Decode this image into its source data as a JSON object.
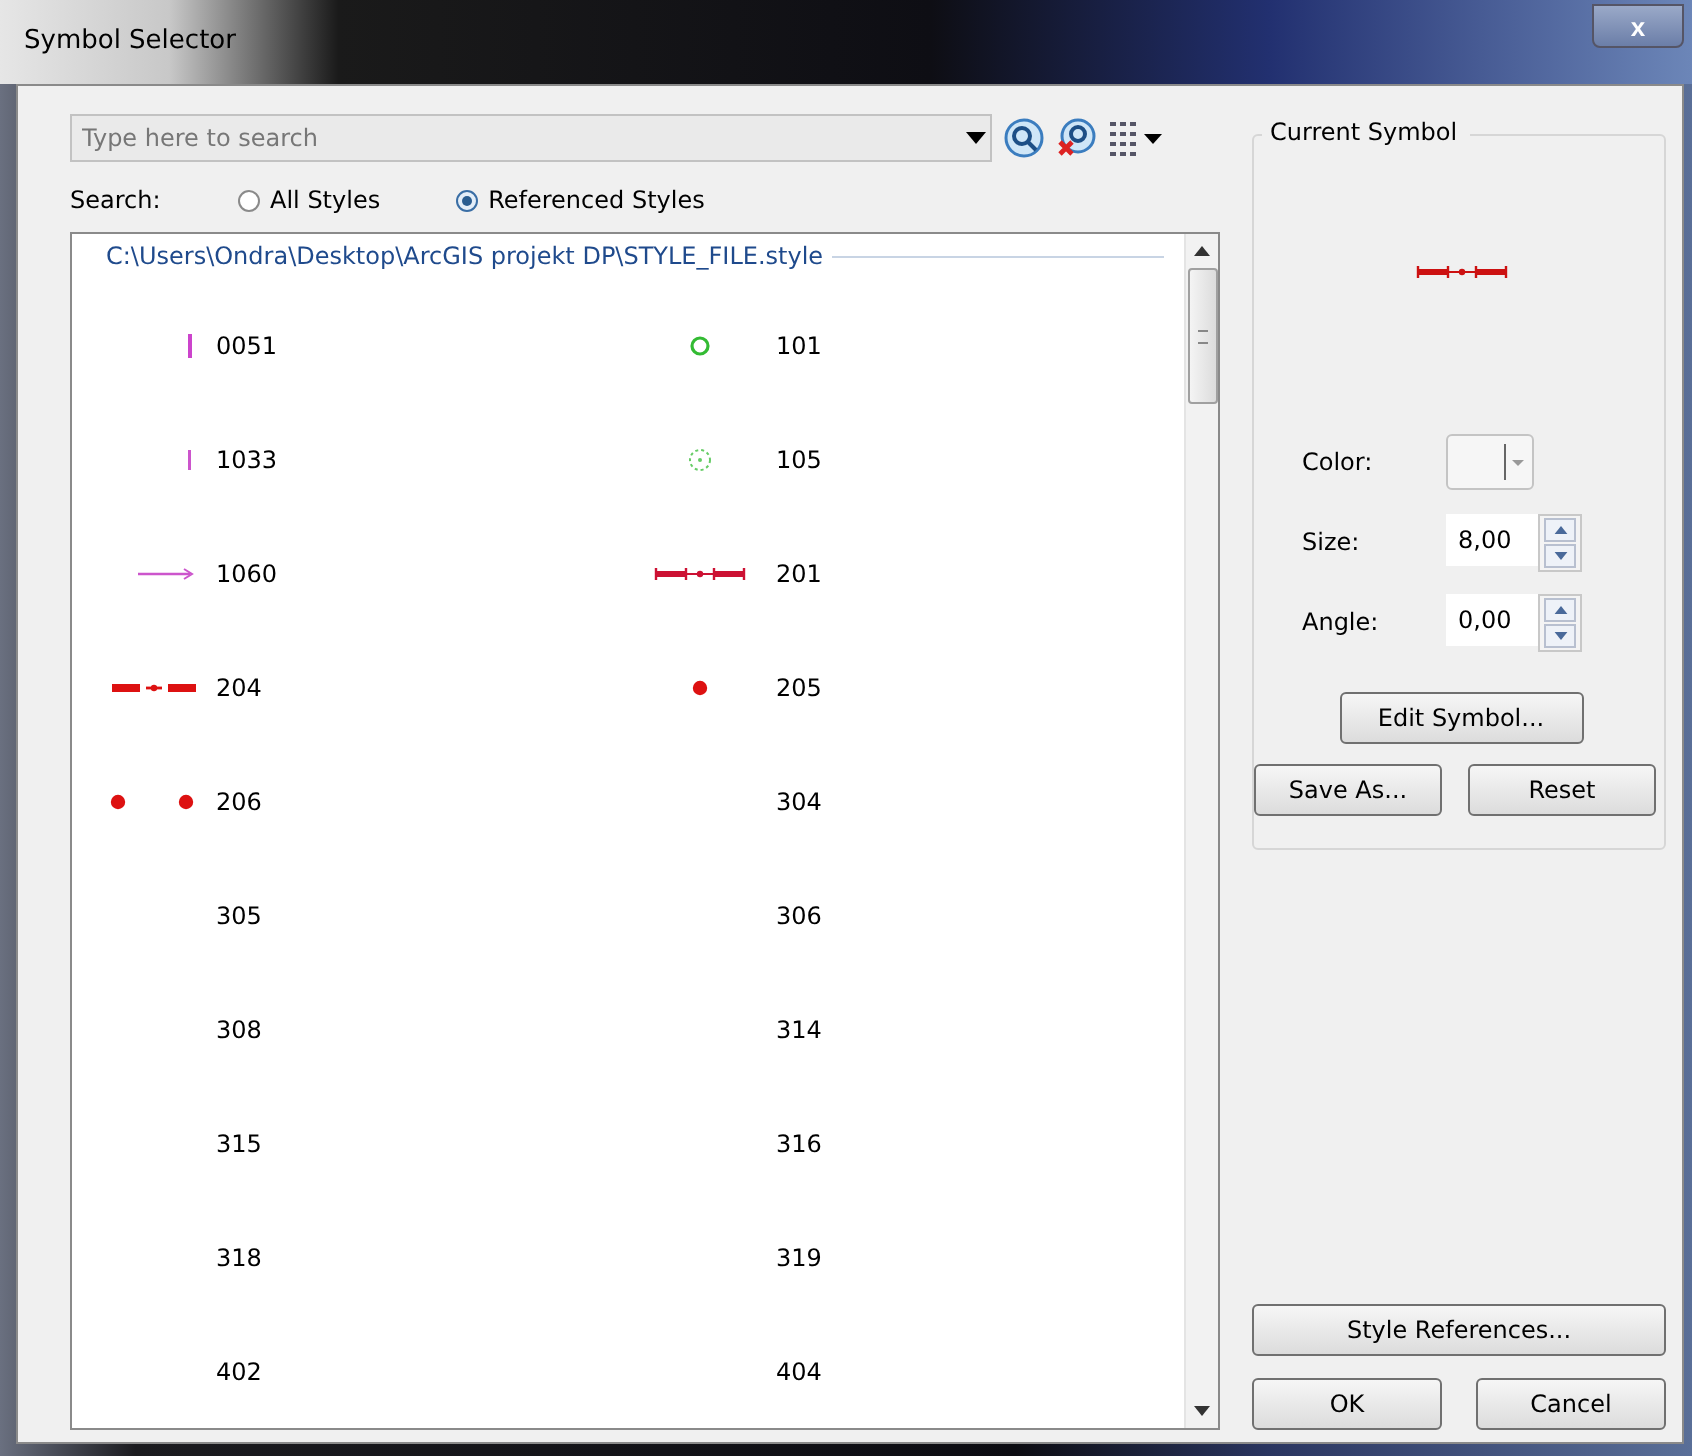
{
  "window": {
    "title": "Symbol Selector",
    "close": "x"
  },
  "search": {
    "placeholder": "Type here to search",
    "label": "Search:",
    "scopes": [
      {
        "label": "All Styles",
        "selected": false
      },
      {
        "label": "Referenced Styles",
        "selected": true
      }
    ]
  },
  "style_file": "C:\\Users\\Ondra\\Desktop\\ArcGIS projekt DP\\STYLE_FILE.style",
  "symbols": [
    {
      "name": "0051",
      "symbol": {
        "kind": "tick",
        "color": "#cc44cc"
      }
    },
    {
      "name": "101",
      "symbol": {
        "kind": "circle",
        "color": "#33bb33"
      }
    },
    {
      "name": "1033",
      "symbol": {
        "kind": "tick-small",
        "color": "#cc55cc"
      }
    },
    {
      "name": "105",
      "symbol": {
        "kind": "dotted-circle",
        "color": "#66cc66"
      }
    },
    {
      "name": "1060",
      "symbol": {
        "kind": "arrow",
        "color": "#cc55cc"
      }
    },
    {
      "name": "201",
      "symbol": {
        "kind": "hatched-line",
        "color": "#cc1133"
      }
    },
    {
      "name": "204",
      "symbol": {
        "kind": "dash-line",
        "color": "#dd1111"
      }
    },
    {
      "name": "205",
      "symbol": {
        "kind": "dot",
        "color": "#dd1111"
      }
    },
    {
      "name": "206",
      "symbol": {
        "kind": "two-dots",
        "color": "#dd1111"
      }
    },
    {
      "name": "304"
    },
    {
      "name": "305"
    },
    {
      "name": "306"
    },
    {
      "name": "308"
    },
    {
      "name": "314"
    },
    {
      "name": "315"
    },
    {
      "name": "316"
    },
    {
      "name": "318"
    },
    {
      "name": "319"
    },
    {
      "name": "402"
    },
    {
      "name": "404"
    }
  ],
  "current_symbol": {
    "title": "Current Symbol",
    "symbol": {
      "kind": "hatched-line",
      "color": "#cc1111"
    },
    "fields": [
      {
        "kind": "color",
        "label": "Color:"
      },
      {
        "kind": "number",
        "label": "Size:",
        "value": "8,00"
      },
      {
        "kind": "number",
        "label": "Angle:",
        "value": "0,00"
      }
    ],
    "edit_button": "Edit Symbol...",
    "buttons": [
      "Save As...",
      "Reset"
    ]
  },
  "footer": {
    "style_references": "Style References...",
    "buttons": [
      "OK",
      "Cancel"
    ]
  }
}
